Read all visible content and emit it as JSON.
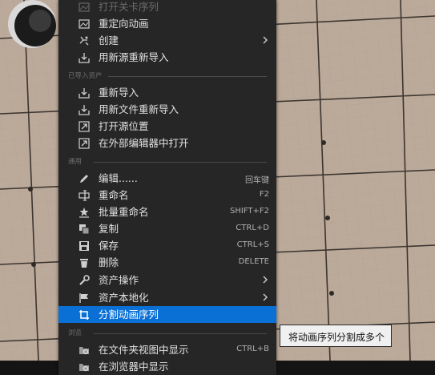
{
  "menu": {
    "items_top": [
      {
        "label": "打开关卡序列",
        "icon": "level-sequence-icon",
        "disabled": true
      },
      {
        "label": "重定向动画",
        "icon": "retarget-animation-icon"
      },
      {
        "label": "创建",
        "icon": "create-icon",
        "submenu": true
      },
      {
        "label": "用新源重新导入",
        "icon": "reimport-new-source-icon"
      }
    ],
    "section_imported": "已导入资产",
    "items_imported": [
      {
        "label": "重新导入",
        "icon": "reimport-icon"
      },
      {
        "label": "用新文件重新导入",
        "icon": "reimport-new-file-icon"
      },
      {
        "label": "打开源位置",
        "icon": "open-source-location-icon"
      },
      {
        "label": "在外部编辑器中打开",
        "icon": "open-external-editor-icon"
      }
    ],
    "section_common": "通用",
    "items_common": [
      {
        "label": "编辑......",
        "shortcut": "回车键",
        "icon": "edit-icon"
      },
      {
        "label": "重命名",
        "shortcut": "F2",
        "icon": "rename-icon"
      },
      {
        "label": "批量重命名",
        "shortcut": "SHIFT+F2",
        "icon": "batch-rename-icon"
      },
      {
        "label": "复制",
        "shortcut": "CTRL+D",
        "icon": "duplicate-icon"
      },
      {
        "label": "保存",
        "shortcut": "CTRL+S",
        "icon": "save-icon"
      },
      {
        "label": "删除",
        "shortcut": "DELETE",
        "icon": "delete-icon"
      },
      {
        "label": "资产操作",
        "icon": "asset-actions-icon",
        "submenu": true
      },
      {
        "label": "资产本地化",
        "icon": "asset-localization-icon",
        "submenu": true
      },
      {
        "label": "分割动画序列",
        "icon": "split-animation-icon",
        "highlighted": true
      }
    ],
    "section_browse": "浏览",
    "items_browse": [
      {
        "label": "在文件夹视图中显示",
        "shortcut": "CTRL+B",
        "icon": "show-in-folder-icon"
      },
      {
        "label": "在浏览器中显示",
        "icon": "show-in-browser-icon"
      }
    ]
  },
  "tooltip": {
    "text": "将动画序列分割成多个"
  },
  "colors": {
    "menu_bg": "#262626",
    "highlight": "#0a70d6",
    "viewport_floor": "#b8a898"
  }
}
